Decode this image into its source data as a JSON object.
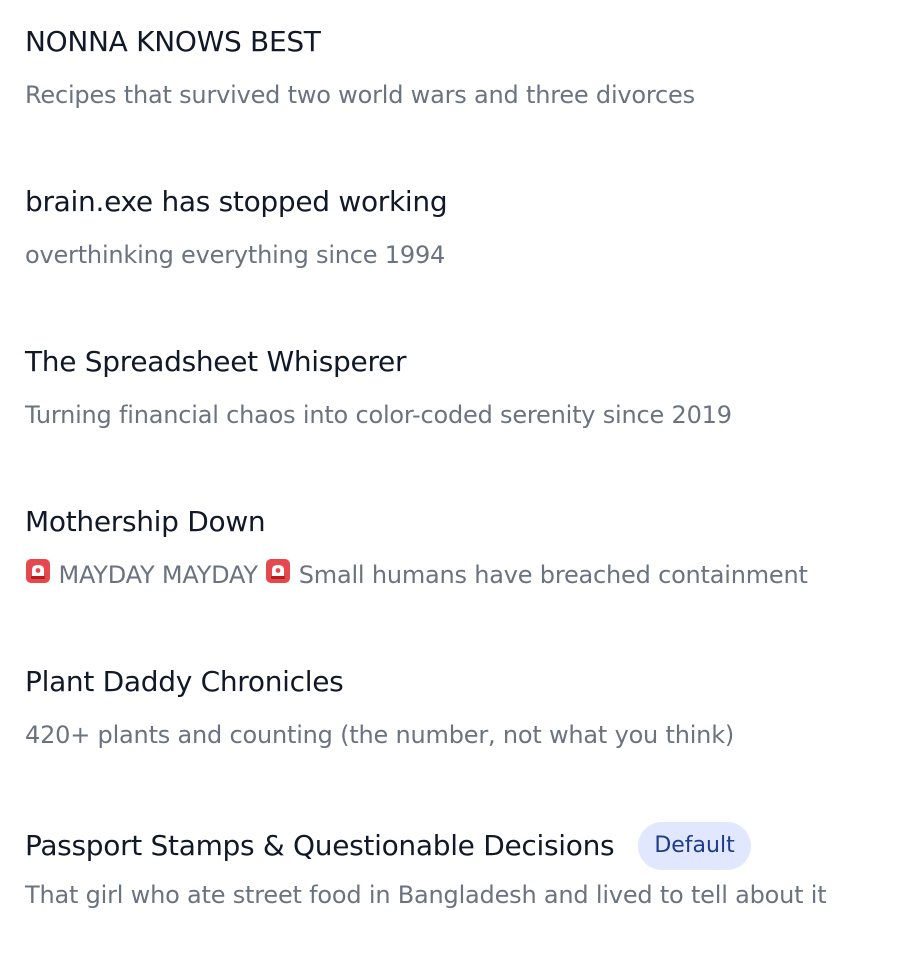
{
  "profiles": [
    {
      "title": "NONNA KNOWS BEST",
      "subtitle": "Recipes that survived two world wars and three divorces"
    },
    {
      "title": "brain.exe has stopped working",
      "subtitle": "overthinking everything since 1994"
    },
    {
      "title": "The Spreadsheet Whisperer",
      "subtitle": "Turning financial chaos into color-coded serenity since 2019"
    },
    {
      "title": "Mothership Down",
      "subtitle_part1": "MAYDAY MAYDAY",
      "subtitle_part2": "Small humans have breached containment",
      "icon": "rotating-light-icon"
    },
    {
      "title": "Plant Daddy Chronicles",
      "subtitle": "420+ plants and counting (the number, not what you think)"
    },
    {
      "title": "Passport Stamps & Questionable Decisions",
      "subtitle": "That girl who ate street food in Bangladesh and lived to tell about it",
      "badge": "Default"
    }
  ],
  "colors": {
    "title": "#111827",
    "subtitle": "#6b7280",
    "badge_bg": "#e0e7ff",
    "badge_text": "#1e3a8a",
    "siren_red": "#e5484d"
  }
}
